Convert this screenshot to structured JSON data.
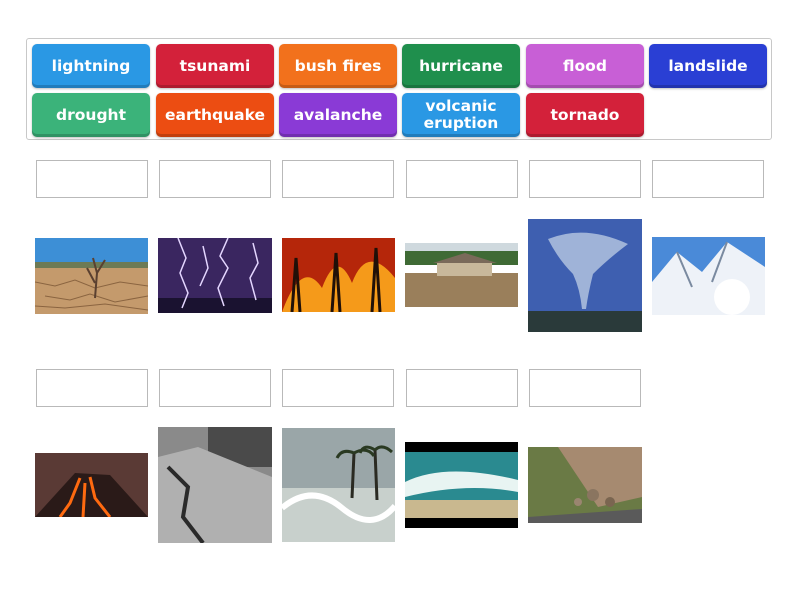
{
  "bank": {
    "tiles": [
      {
        "label": "lightning",
        "color": "#2a98e4"
      },
      {
        "label": "tsunami",
        "color": "#d3213a"
      },
      {
        "label": "bush fires",
        "color": "#f2711c"
      },
      {
        "label": "hurricane",
        "color": "#1f8f4d"
      },
      {
        "label": "flood",
        "color": "#c85fd6"
      },
      {
        "label": "landslide",
        "color": "#2a3fd4"
      },
      {
        "label": "drought",
        "color": "#3bb37a"
      },
      {
        "label": "earthquake",
        "color": "#ec4d12"
      },
      {
        "label": "avalanche",
        "color": "#8a3ad6"
      },
      {
        "label": "volcanic\neruption",
        "color": "#2a98e4"
      },
      {
        "label": "tornado",
        "color": "#d3213a"
      }
    ]
  },
  "images": [
    {
      "icon": "drought-photo-icon"
    },
    {
      "icon": "lightning-photo-icon"
    },
    {
      "icon": "bush-fire-photo-icon"
    },
    {
      "icon": "flood-photo-icon"
    },
    {
      "icon": "tornado-photo-icon"
    },
    {
      "icon": "avalanche-photo-icon"
    },
    {
      "icon": "volcanic-eruption-photo-icon"
    },
    {
      "icon": "earthquake-photo-icon"
    },
    {
      "icon": "hurricane-photo-icon"
    },
    {
      "icon": "tsunami-photo-icon"
    },
    {
      "icon": "landslide-photo-icon"
    }
  ]
}
